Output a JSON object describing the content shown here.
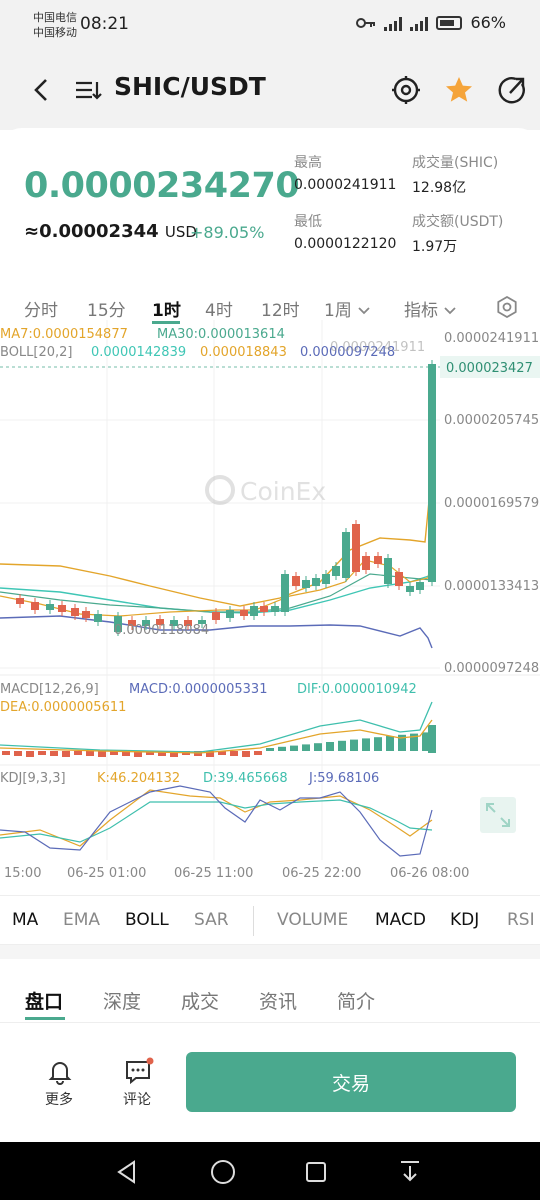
{
  "status": {
    "carrier1": "中国电信",
    "carrier2": "中国移动",
    "time": "08:21",
    "battery": "66%"
  },
  "header": {
    "title": "SHIC/USDT"
  },
  "ticker": {
    "price": "0.0000234270",
    "usd_price": "≈0.00002344",
    "usd_unit": "USD",
    "change": "+89.05%",
    "high_label": "最高",
    "high_value": "0.0000241911",
    "low_label": "最低",
    "low_value": "0.0000122120",
    "vol_label": "成交量(SHIC)",
    "vol_value": "12.98亿",
    "turnover_label": "成交额(USDT)",
    "turnover_value": "1.97万"
  },
  "timeframes": [
    "分时",
    "15分",
    "1时",
    "4时",
    "12时",
    "1周",
    "指标"
  ],
  "chart": {
    "ma7": "MA7:0.0000154877",
    "ma30": "MA30:0.000013614",
    "boll_label": "BOLL[20,2]",
    "boll_mid": "0.0000142839",
    "boll_up": "0.000018843",
    "boll_low": "0.0000097248",
    "high_marker": "0.0000241911",
    "low_marker": "0.0000118084",
    "watermark": "CoinEx",
    "last_price_tag": "0.000023427",
    "price_axis": [
      "0.0000241911",
      "0.0000205745",
      "0.0000169579",
      "0.0000133413",
      "0.0000097248"
    ],
    "macd_label": "MACD[12,26,9]",
    "macd_value": "MACD:0.0000005331",
    "dif_value": "DIF:0.0000010942",
    "dea_value": "DEA:0.0000005611",
    "kdj_label": "KDJ[9,3,3]",
    "k_value": "K:46.204132",
    "d_value": "D:39.465668",
    "j_value": "J:59.68106",
    "time_axis": [
      "15:00",
      "06-25 01:00",
      "06-25 11:00",
      "06-25 22:00",
      "06-26 08:00"
    ]
  },
  "indicators": [
    "MA",
    "EMA",
    "BOLL",
    "SAR",
    "VOLUME",
    "MACD",
    "KDJ",
    "RSI"
  ],
  "bottom_tabs": [
    "盘口",
    "深度",
    "成交",
    "资讯",
    "简介"
  ],
  "actions": {
    "more": "更多",
    "comment": "评论",
    "trade": "交易"
  },
  "colors": {
    "up": "#4aa98e",
    "down": "#e0634b",
    "accent": "#4aa98e",
    "star": "#f5a43a"
  }
}
